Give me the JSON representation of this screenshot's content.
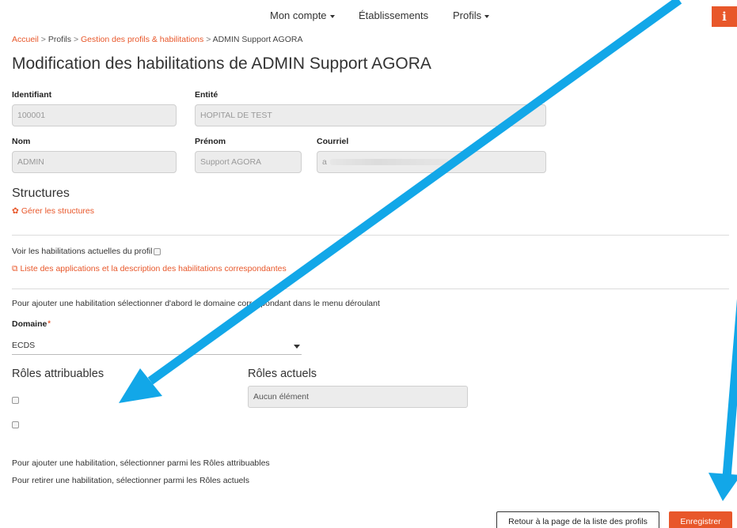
{
  "nav": {
    "account": "Mon compte",
    "establishments": "Établissements",
    "profiles": "Profils",
    "info_glyph": "i"
  },
  "breadcrumb": {
    "home": "Accueil",
    "profiles": "Profils",
    "management": "Gestion des profils & habilitations",
    "current": "ADMIN Support AGORA",
    "separator": ">"
  },
  "page_title": "Modification des habilitations de ADMIN Support AGORA",
  "form": {
    "identifier_label": "Identifiant",
    "identifier_value": "100001",
    "entity_label": "Entité",
    "entity_value": "HOPITAL DE TEST",
    "lastname_label": "Nom",
    "lastname_value": "ADMIN",
    "firstname_label": "Prénom",
    "firstname_value": "Support AGORA",
    "email_label": "Courriel",
    "email_value": "a"
  },
  "structures": {
    "title": "Structures",
    "manage_link": "Gérer les structures"
  },
  "habilitations": {
    "view_current_label": "Voir les habilitations actuelles du profil",
    "apps_link": "Liste des applications et la description des habilitations correspondantes",
    "instruction": "Pour ajouter une habilitation sélectionner d'abord le domaine correspondant dans le menu déroulant",
    "domain_label": "Domaine",
    "required_mark": "*",
    "domain_value": "ECDS"
  },
  "roles": {
    "assignable_title": "Rôles attribuables",
    "current_title": "Rôles actuels",
    "current_empty": "Aucun élément"
  },
  "help": {
    "add": "Pour ajouter une habilitation, sélectionner parmi les Rôles attribuables",
    "remove": "Pour retirer une habilitation, sélectionner parmi les Rôles actuels"
  },
  "buttons": {
    "back": "Retour à la page de la liste des profils",
    "save": "Enregistrer"
  },
  "colors": {
    "accent": "#e8572a",
    "annotation_arrow": "#12a7e8"
  }
}
